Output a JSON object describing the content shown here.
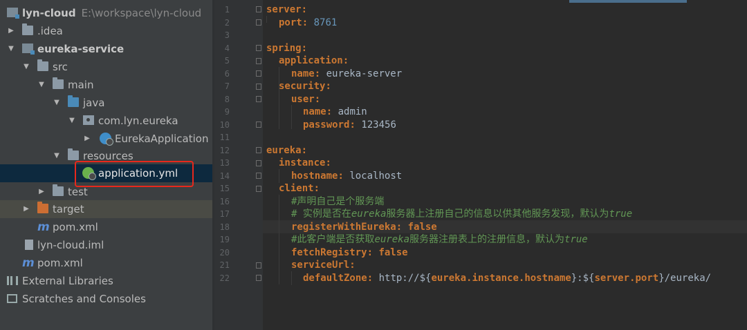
{
  "project_tree": {
    "root": {
      "name": "lyn-cloud",
      "path": "E:\\workspace\\lyn-cloud"
    },
    "items": [
      {
        "label": "lyn-cloud",
        "extra": "E:\\workspace\\lyn-cloud"
      },
      {
        "label": ".idea"
      },
      {
        "label": "eureka-service"
      },
      {
        "label": "src"
      },
      {
        "label": "main"
      },
      {
        "label": "java"
      },
      {
        "label": "com.lyn.eureka"
      },
      {
        "label": "EurekaApplication"
      },
      {
        "label": "resources"
      },
      {
        "label": "application.yml"
      },
      {
        "label": "test"
      },
      {
        "label": "target"
      },
      {
        "label": "pom.xml"
      },
      {
        "label": "lyn-cloud.iml"
      },
      {
        "label": "pom.xml"
      },
      {
        "label": "External Libraries"
      },
      {
        "label": "Scratches and Consoles"
      }
    ],
    "icon_m": "m"
  },
  "editor": {
    "line_numbers": [
      "1",
      "2",
      "3",
      "4",
      "5",
      "6",
      "7",
      "8",
      "9",
      "10",
      "11",
      "12",
      "13",
      "14",
      "15",
      "16",
      "17",
      "18",
      "19",
      "20",
      "21",
      "22"
    ],
    "lines": [
      {
        "key": "server",
        "colon": ":"
      },
      {
        "key": "port",
        "colon": ":",
        "value": "8761"
      },
      {},
      {
        "key": "spring",
        "colon": ":"
      },
      {
        "key": "application",
        "colon": ":"
      },
      {
        "key": "name",
        "colon": ":",
        "value": "eureka-server"
      },
      {
        "key": "security",
        "colon": ":"
      },
      {
        "key": "user",
        "colon": ":"
      },
      {
        "key": "name",
        "colon": ":",
        "value": "admin"
      },
      {
        "key": "password",
        "colon": ":",
        "value": "123456"
      },
      {},
      {
        "key": "eureka",
        "colon": ":"
      },
      {
        "key": "instance",
        "colon": ":"
      },
      {
        "key": "hostname",
        "colon": ":",
        "value": "localhost"
      },
      {
        "key": "client",
        "colon": ":"
      },
      {
        "comment": "#声明自己是个服务端"
      },
      {
        "comment_a": "# 实例是否在",
        "comment_b": "eureka",
        "comment_c": "服务器上注册自己的信息以供其他服务发现，默认为",
        "comment_d": "true"
      },
      {
        "key": "registerWithEureka",
        "colon": ":",
        "value": "false"
      },
      {
        "comment_a": "#此客户端是否获取",
        "comment_b": "eureka",
        "comment_c": "服务器注册表上的注册信息，默认为",
        "comment_d": "true"
      },
      {
        "key": "fetchRegistry",
        "colon": ":",
        "value": "false"
      },
      {
        "key": "serviceUrl",
        "colon": ":"
      },
      {
        "key": "defaultZone",
        "colon": ":",
        "value_a": "http://${",
        "value_b": "eureka.instance.hostname",
        "value_c": "}:${",
        "value_d": "server.port",
        "value_e": "}/eureka/"
      }
    ]
  },
  "colors": {
    "keyword": "#cc7832",
    "number": "#6897bb",
    "comment": "#629755",
    "text": "#a9b7c6",
    "highlight": "#e8281c"
  }
}
